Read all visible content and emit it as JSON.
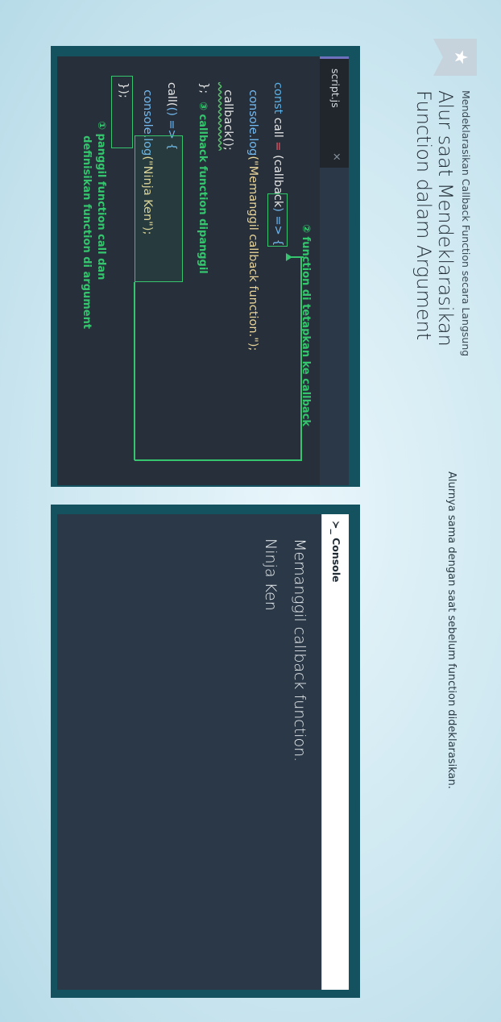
{
  "slide": {
    "breadcrumb": "Mendeklarasikan Callback Function secara Langsung",
    "title_line1": "Alur saat Mendeklarasikan",
    "title_line2": "Function dalam Argument",
    "description": "Alurnya sama dengan saat sebelum function dideklarasikan.",
    "bookmark_icon": "star-icon"
  },
  "editor": {
    "tab_label": "script.js",
    "tab_close": "×",
    "code": {
      "l1_kw": "const",
      "l1_name": " call ",
      "l1_eq": "=",
      "l1_paren_open": " (",
      "l1_param": "callback",
      "l1_rest": ") => {",
      "l2_console": "  console.log",
      "l2_str": "(\"Memanggil callback function.\");",
      "l3_call": "  callback();",
      "l4_close": "};",
      "l5_call": "call(",
      "l5_arrow": "() => {",
      "l6_console": "  console.log",
      "l6_str": "(\"Ninja Ken\");",
      "l7_close": "});"
    },
    "annotations": {
      "a2": "② function di tetapkan ke callback",
      "a3": "③ callback function dipanggil",
      "a1_line1": "① panggil function call dan",
      "a1_line2": "    definisikan function di argument"
    }
  },
  "console": {
    "header": "≻_ Console",
    "output": [
      "Memanggil callback function.",
      "Ninja Ken"
    ]
  }
}
